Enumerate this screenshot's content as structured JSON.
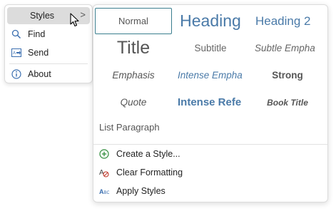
{
  "context_menu": {
    "items": [
      {
        "label": "Styles",
        "icon": "none",
        "has_submenu": true,
        "highlighted": true
      },
      {
        "label": "Find",
        "icon": "search-icon"
      },
      {
        "label": "Send",
        "icon": "send-icon"
      },
      {
        "label": "About",
        "icon": "info-icon"
      }
    ],
    "submenu_chevron": ">"
  },
  "styles_gallery": {
    "tiles": [
      {
        "label": "Normal",
        "selected": true
      },
      {
        "label": "Heading"
      },
      {
        "label": "Heading 2"
      },
      {
        "label": "Title"
      },
      {
        "label": "Subtitle"
      },
      {
        "label": "Subtle Empha"
      },
      {
        "label": "Emphasis"
      },
      {
        "label": "Intense Empha"
      },
      {
        "label": "Strong"
      },
      {
        "label": "Quote"
      },
      {
        "label": "Intense Refe"
      },
      {
        "label": "Book Title"
      }
    ],
    "list_paragraph": "List Paragraph",
    "actions": [
      {
        "label": "Create a Style...",
        "icon": "plus-circle-icon"
      },
      {
        "label": "Clear Formatting",
        "icon": "clear-format-icon"
      },
      {
        "label": "Apply Styles",
        "icon": "apply-styles-icon"
      }
    ]
  },
  "colors": {
    "accent": "#3a7e8e",
    "heading_blue": "#4a7aa8",
    "highlight": "#dcdcdc",
    "create_icon": "#2e8b3a",
    "clear_icon": "#c0392b"
  }
}
